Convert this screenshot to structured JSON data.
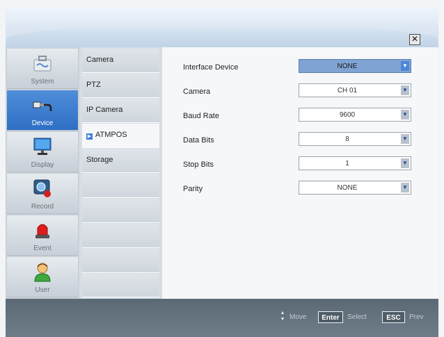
{
  "header": {
    "close_label": "✕"
  },
  "categories": [
    {
      "label": "System",
      "icon": "toolbox-icon",
      "active": false
    },
    {
      "label": "Device",
      "icon": "device-cable-icon",
      "active": true
    },
    {
      "label": "Display",
      "icon": "monitor-icon",
      "active": false
    },
    {
      "label": "Record",
      "icon": "record-camera-icon",
      "active": false
    },
    {
      "label": "Event",
      "icon": "alarm-siren-icon",
      "active": false
    },
    {
      "label": "User",
      "icon": "user-icon",
      "active": false
    }
  ],
  "submenu": [
    {
      "label": "Camera"
    },
    {
      "label": "PTZ"
    },
    {
      "label": "IP Camera"
    },
    {
      "label": "ATMPOS",
      "active": true
    },
    {
      "label": "Storage"
    }
  ],
  "settings": [
    {
      "label": "Interface Device",
      "value": "NONE",
      "highlighted": true
    },
    {
      "label": "Camera",
      "value": "CH 01"
    },
    {
      "label": "Baud Rate",
      "value": "9600"
    },
    {
      "label": "Data Bits",
      "value": "8"
    },
    {
      "label": "Stop Bits",
      "value": "1"
    },
    {
      "label": "Parity",
      "value": "NONE"
    }
  ],
  "footer": {
    "move_label": "Move",
    "enter_key": "Enter",
    "select_label": "Select",
    "esc_key": "ESC",
    "prev_label": "Prev"
  }
}
